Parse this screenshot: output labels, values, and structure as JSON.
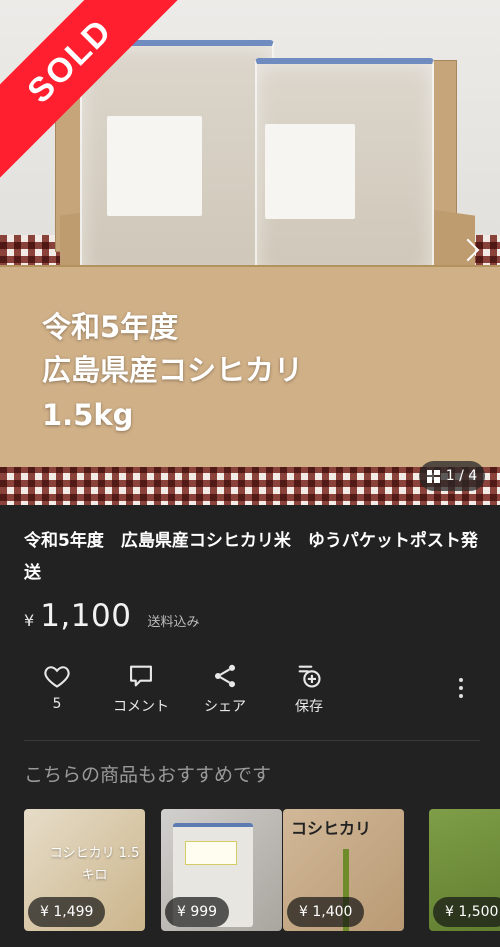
{
  "hero": {
    "overlay_line1": "令和5年度",
    "overlay_line2": "広島県産コシヒカリ",
    "overlay_line3": "1.5kg",
    "sold_label": "SOLD",
    "counter": "1 / 4"
  },
  "item": {
    "title": "令和5年度　広島県産コシヒカリ米　ゆうパケットポスト発送",
    "currency": "¥",
    "price": "1,100",
    "shipping": "送料込み"
  },
  "actions": {
    "like_count": "5",
    "comment_label": "コメント",
    "share_label": "シェア",
    "save_label": "保存"
  },
  "recommendations": {
    "heading": "こちらの商品もおすすめです",
    "items": [
      {
        "image_text": "コシヒカリ 1.5キロ",
        "price": "¥ 1,499"
      },
      {
        "image_text": "",
        "price": "¥ 999"
      },
      {
        "image_text": "コシヒカリ",
        "price": "¥ 1,400"
      },
      {
        "image_text": "",
        "price": "¥ 1,500"
      }
    ]
  },
  "colors": {
    "background": "#222222",
    "sold_ribbon": "#ff1f2f"
  }
}
